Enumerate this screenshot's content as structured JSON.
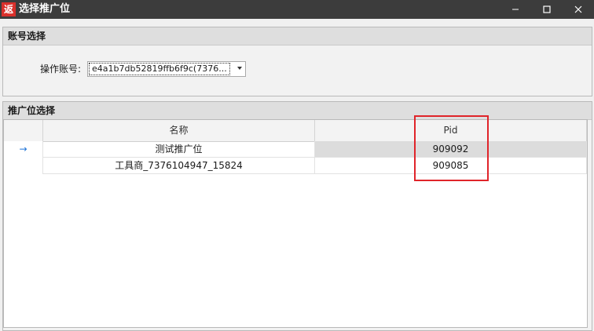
{
  "window": {
    "icon_text": "返",
    "title": "选择推广位"
  },
  "account_group": {
    "header": "账号选择",
    "label": "操作账号:",
    "selected_value": "e4a1b7db52819ffb6f9c(7376..."
  },
  "position_group": {
    "header": "推广位选择",
    "columns": [
      "名称",
      "Pid"
    ],
    "rows": [
      {
        "name": "测试推广位",
        "pid": "909092",
        "selected": true
      },
      {
        "name": "工具商_7376104947_15824",
        "pid": "909085",
        "selected": false
      }
    ],
    "current_row_marker": "→"
  },
  "colors": {
    "titlebar": "#3c3c3c",
    "app_icon": "#d9302b",
    "highlight": "#e0242a",
    "selection_gray": "#dcdcdc",
    "row_marker": "#1e73d6"
  }
}
